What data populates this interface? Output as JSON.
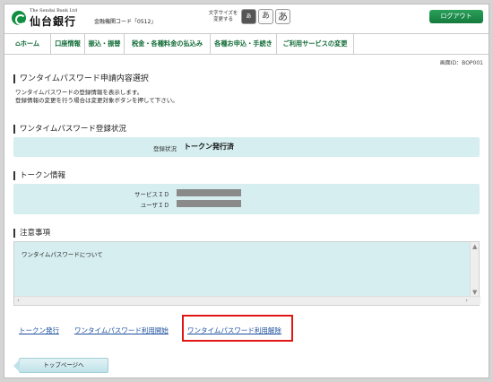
{
  "header": {
    "logo_en": "The Sendai Bank Ltd",
    "logo_jp": "仙台銀行",
    "bank_code": "金融機関コード「0512」",
    "fontsize_label_line1": "文字サイズを",
    "fontsize_label_line2": "変更する",
    "fontsize_small": "あ",
    "fontsize_mid": "あ",
    "fontsize_large": "あ",
    "logout_label": "ログアウト"
  },
  "nav": {
    "home_icon": "⌂",
    "home": "ホーム",
    "account": "口座情報",
    "transfer": "振込・振替",
    "tax": "税金・各種料金の払込み",
    "apply": "各種お申込・手続き",
    "services": "ご利用サービスの変更"
  },
  "screen_id": "画面ID：BOP001",
  "page": {
    "title": "ワンタイムパスワード申請内容選択",
    "desc_line1": "ワンタイムパスワードの登録情報を表示します。",
    "desc_line2": "登録情報の変更を行う場合は変更対象ボタンを押して下さい。"
  },
  "registration": {
    "heading": "ワンタイムパスワード登録状況",
    "status_label": "登録状況",
    "status_value": "トークン発行済"
  },
  "token": {
    "heading": "トークン情報",
    "service_id_label": "サービスＩＤ",
    "user_id_label": "ユーザＩＤ"
  },
  "notes": {
    "heading": "注意事項",
    "text": "ワンタイムパスワードについて"
  },
  "links": {
    "issue": "トークン発行",
    "start": "ワンタイムパスワード利用開始",
    "cancel": "ワンタイムパスワード利用解除"
  },
  "top_button": "トップページへ",
  "colors": {
    "brand_green": "#0f8f3f",
    "panel_bg": "#d6eef0",
    "link": "#1d4f9e",
    "highlight": "#e21515"
  }
}
